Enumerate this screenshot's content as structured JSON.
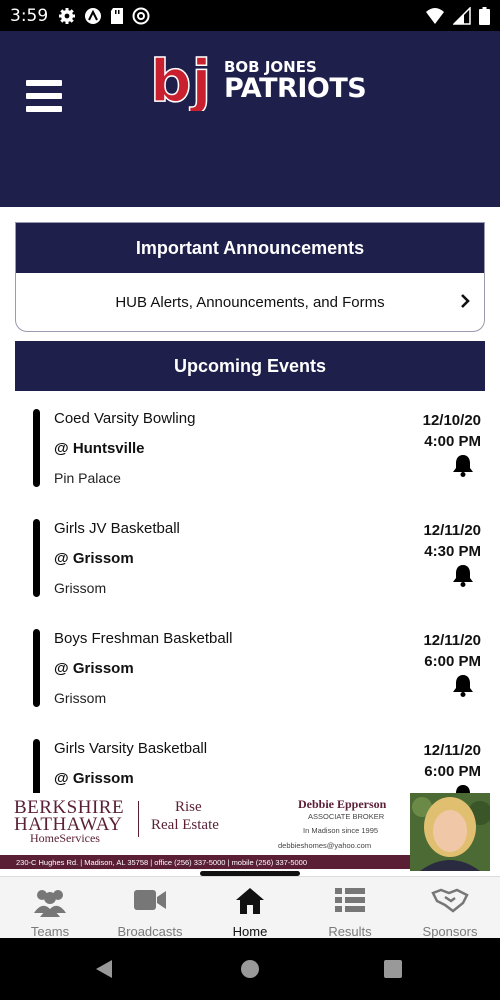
{
  "status_bar": {
    "time": "3:59",
    "left_icons": [
      "settings-gear-icon",
      "vpn-icon",
      "sd-card-icon",
      "at-sign-icon"
    ],
    "right_icons": [
      "wifi-icon",
      "cellular-icon",
      "battery-icon"
    ]
  },
  "header": {
    "logo_mark": "bj",
    "logo_top": "BOB JONES",
    "logo_bottom": "PATRIOTS",
    "brand_color": "#1e1f4b",
    "logo_red": "#c8202f"
  },
  "announcements": {
    "title": "Important Announcements",
    "link_label": "HUB Alerts, Announcements, and Forms"
  },
  "events": {
    "title": "Upcoming Events",
    "items": [
      {
        "name": "Coed Varsity Bowling",
        "at": "@",
        "opponent": "Huntsville",
        "location": "Pin Palace",
        "date": "12/10/20",
        "time": "4:00 PM"
      },
      {
        "name": "Girls JV Basketball",
        "at": "@",
        "opponent": "Grissom",
        "location": "Grissom",
        "date": "12/11/20",
        "time": "4:30 PM"
      },
      {
        "name": "Boys Freshman Basketball",
        "at": "@",
        "opponent": "Grissom",
        "location": "Grissom",
        "date": "12/11/20",
        "time": "6:00 PM"
      },
      {
        "name": "Girls Varsity Basketball",
        "at": "@",
        "opponent": "Grissom",
        "location": "",
        "date": "12/11/20",
        "time": "6:00 PM"
      }
    ]
  },
  "ad": {
    "brand_line1": "BERKSHIRE",
    "brand_line2": "HATHAWAY",
    "brand_line3": "HomeServices",
    "partner_line1": "Rise",
    "partner_line2": "Real Estate",
    "agent_name": "Debbie Epperson",
    "agent_title": "ASSOCIATE BROKER",
    "agent_since": "In Madison since 1995",
    "agent_email": "debbieshomes@yahoo.com",
    "footer": "230-C Hughes Rd.  |  Madison, AL 35758  |  office (256) 337-5000  |  mobile (256) 337-5000",
    "accent": "#5a1f35"
  },
  "bottom_nav": {
    "items": [
      {
        "label": "Teams",
        "icon": "people-icon"
      },
      {
        "label": "Broadcasts",
        "icon": "video-camera-icon"
      },
      {
        "label": "Home",
        "icon": "home-icon",
        "active": true
      },
      {
        "label": "Results",
        "icon": "list-icon"
      },
      {
        "label": "Sponsors",
        "icon": "handshake-icon"
      }
    ]
  },
  "system_nav": {
    "items": [
      "back-icon",
      "home-circle-icon",
      "recents-icon"
    ]
  }
}
